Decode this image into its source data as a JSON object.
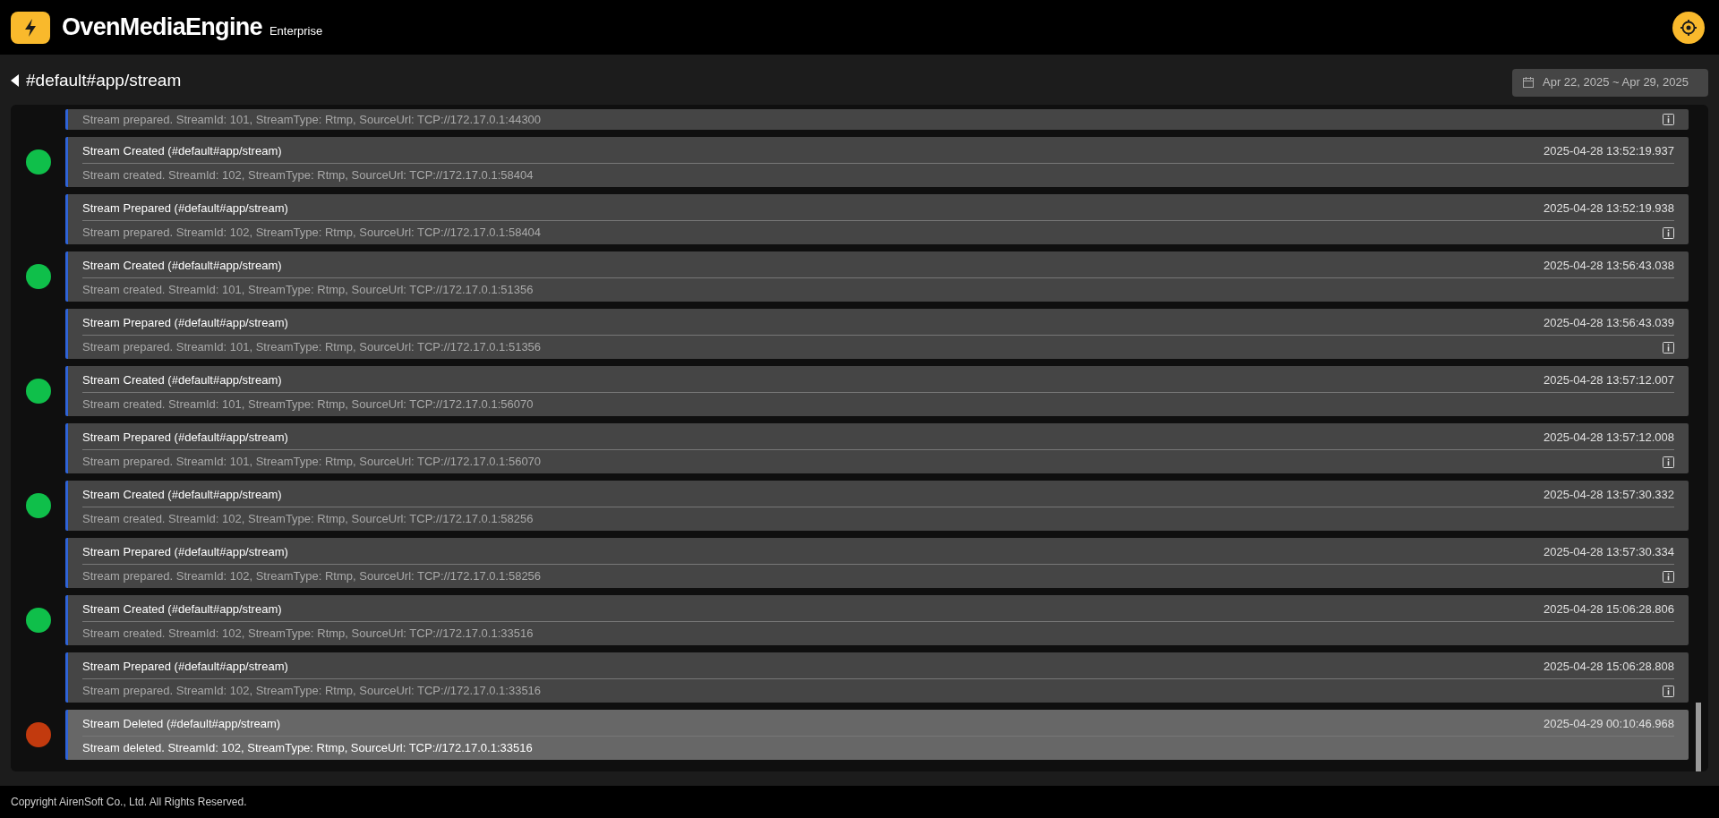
{
  "header": {
    "title": "OvenMediaEngine",
    "edition": "Enterprise"
  },
  "subheader": {
    "stream_path": "#default#app/stream",
    "date_range": "Apr 22, 2025 ~ Apr 29, 2025"
  },
  "events": [
    {
      "kind": "prepared",
      "partial": true,
      "selected": false,
      "message": "Stream prepared. StreamId: 101, StreamType: Rtmp, SourceUrl: TCP://172.17.0.1:44300"
    },
    {
      "kind": "created",
      "partial": false,
      "selected": false,
      "title": "Stream Created (#default#app/stream)",
      "time": "2025-04-28 13:52:19.937",
      "message": "Stream created. StreamId: 102, StreamType: Rtmp, SourceUrl: TCP://172.17.0.1:58404"
    },
    {
      "kind": "prepared",
      "partial": false,
      "selected": false,
      "title": "Stream Prepared (#default#app/stream)",
      "time": "2025-04-28 13:52:19.938",
      "message": "Stream prepared. StreamId: 102, StreamType: Rtmp, SourceUrl: TCP://172.17.0.1:58404"
    },
    {
      "kind": "created",
      "partial": false,
      "selected": false,
      "title": "Stream Created (#default#app/stream)",
      "time": "2025-04-28 13:56:43.038",
      "message": "Stream created. StreamId: 101, StreamType: Rtmp, SourceUrl: TCP://172.17.0.1:51356"
    },
    {
      "kind": "prepared",
      "partial": false,
      "selected": false,
      "title": "Stream Prepared (#default#app/stream)",
      "time": "2025-04-28 13:56:43.039",
      "message": "Stream prepared. StreamId: 101, StreamType: Rtmp, SourceUrl: TCP://172.17.0.1:51356"
    },
    {
      "kind": "created",
      "partial": false,
      "selected": false,
      "title": "Stream Created (#default#app/stream)",
      "time": "2025-04-28 13:57:12.007",
      "message": "Stream created. StreamId: 101, StreamType: Rtmp, SourceUrl: TCP://172.17.0.1:56070"
    },
    {
      "kind": "prepared",
      "partial": false,
      "selected": false,
      "title": "Stream Prepared (#default#app/stream)",
      "time": "2025-04-28 13:57:12.008",
      "message": "Stream prepared. StreamId: 101, StreamType: Rtmp, SourceUrl: TCP://172.17.0.1:56070"
    },
    {
      "kind": "created",
      "partial": false,
      "selected": false,
      "title": "Stream Created (#default#app/stream)",
      "time": "2025-04-28 13:57:30.332",
      "message": "Stream created. StreamId: 102, StreamType: Rtmp, SourceUrl: TCP://172.17.0.1:58256"
    },
    {
      "kind": "prepared",
      "partial": false,
      "selected": false,
      "title": "Stream Prepared (#default#app/stream)",
      "time": "2025-04-28 13:57:30.334",
      "message": "Stream prepared. StreamId: 102, StreamType: Rtmp, SourceUrl: TCP://172.17.0.1:58256"
    },
    {
      "kind": "created",
      "partial": false,
      "selected": false,
      "title": "Stream Created (#default#app/stream)",
      "time": "2025-04-28 15:06:28.806",
      "message": "Stream created. StreamId: 102, StreamType: Rtmp, SourceUrl: TCP://172.17.0.1:33516"
    },
    {
      "kind": "prepared",
      "partial": false,
      "selected": false,
      "title": "Stream Prepared (#default#app/stream)",
      "time": "2025-04-28 15:06:28.808",
      "message": "Stream prepared. StreamId: 102, StreamType: Rtmp, SourceUrl: TCP://172.17.0.1:33516"
    },
    {
      "kind": "deleted",
      "partial": false,
      "selected": true,
      "title": "Stream Deleted (#default#app/stream)",
      "time": "2025-04-29 00:10:46.968",
      "message": "Stream deleted. StreamId: 102, StreamType: Rtmp, SourceUrl: TCP://172.17.0.1:33516"
    }
  ],
  "footer": {
    "copyright": "Copyright AirenSoft Co., Ltd. All Rights Reserved."
  }
}
